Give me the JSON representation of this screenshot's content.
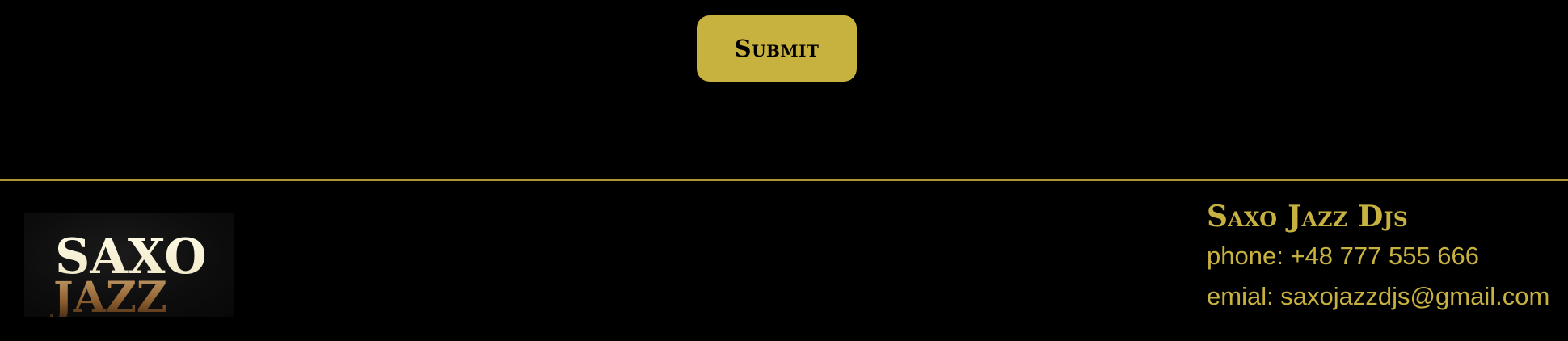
{
  "form": {
    "submit_label": "Submit"
  },
  "footer": {
    "logo": {
      "text_top": "SAXO",
      "text_bottom": "JAZZ"
    },
    "title": "Saxo Jazz Djs",
    "phone": "phone: +48 777 555 666",
    "email": "emial: saxojazzdjs@gmail.com"
  },
  "colors": {
    "background": "#000000",
    "accent_gold": "#c8b23f",
    "button_text": "#000000"
  }
}
